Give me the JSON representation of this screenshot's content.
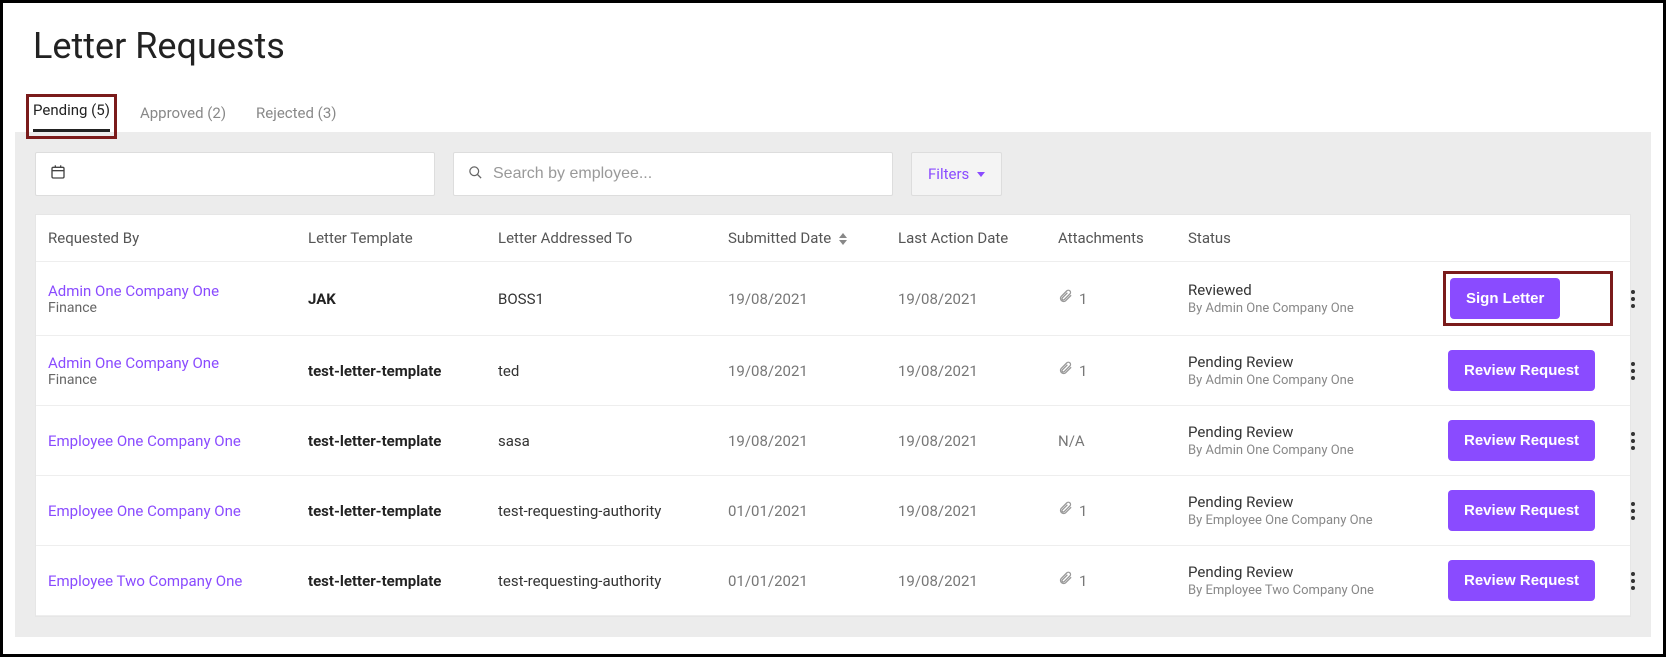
{
  "pageTitle": "Letter Requests",
  "tabs": [
    {
      "label": "Pending (5)",
      "active": true,
      "highlight": true
    },
    {
      "label": "Approved (2)",
      "active": false,
      "highlight": false
    },
    {
      "label": "Rejected (3)",
      "active": false,
      "highlight": false
    }
  ],
  "search": {
    "placeholder": "Search by employee..."
  },
  "filters": {
    "label": "Filters"
  },
  "columns": {
    "requestedBy": "Requested By",
    "letterTemplate": "Letter Template",
    "addressedTo": "Letter Addressed To",
    "submittedDate": "Submitted Date",
    "lastActionDate": "Last Action Date",
    "attachments": "Attachments",
    "status": "Status"
  },
  "rows": [
    {
      "requestedBy": "Admin One Company One",
      "requestedBySub": "Finance",
      "template": "JAK",
      "addressedTo": "BOSS1",
      "submitted": "19/08/2021",
      "lastAction": "19/08/2021",
      "attachIcon": true,
      "attachCount": "1",
      "statusMain": "Reviewed",
      "statusSub": "By Admin One Company One",
      "action": "Sign Letter",
      "actionHighlight": true
    },
    {
      "requestedBy": "Admin One Company One",
      "requestedBySub": "Finance",
      "template": "test-letter-template",
      "addressedTo": "ted",
      "submitted": "19/08/2021",
      "lastAction": "19/08/2021",
      "attachIcon": true,
      "attachCount": "1",
      "statusMain": "Pending Review",
      "statusSub": "By Admin One Company One",
      "action": "Review Request",
      "actionHighlight": false
    },
    {
      "requestedBy": "Employee One Company One",
      "requestedBySub": "",
      "template": "test-letter-template",
      "addressedTo": "sasa",
      "submitted": "19/08/2021",
      "lastAction": "19/08/2021",
      "attachIcon": false,
      "attachCount": "N/A",
      "statusMain": "Pending Review",
      "statusSub": "By Admin One Company One",
      "action": "Review Request",
      "actionHighlight": false
    },
    {
      "requestedBy": "Employee One Company One",
      "requestedBySub": "",
      "template": "test-letter-template",
      "addressedTo": "test-requesting-authority",
      "submitted": "01/01/2021",
      "lastAction": "19/08/2021",
      "attachIcon": true,
      "attachCount": "1",
      "statusMain": "Pending Review",
      "statusSub": "By Employee One Company One",
      "action": "Review Request",
      "actionHighlight": false
    },
    {
      "requestedBy": "Employee Two Company One",
      "requestedBySub": "",
      "template": "test-letter-template",
      "addressedTo": "test-requesting-authority",
      "submitted": "01/01/2021",
      "lastAction": "19/08/2021",
      "attachIcon": true,
      "attachCount": "1",
      "statusMain": "Pending Review",
      "statusSub": "By Employee Two Company One",
      "action": "Review Request",
      "actionHighlight": false
    }
  ]
}
